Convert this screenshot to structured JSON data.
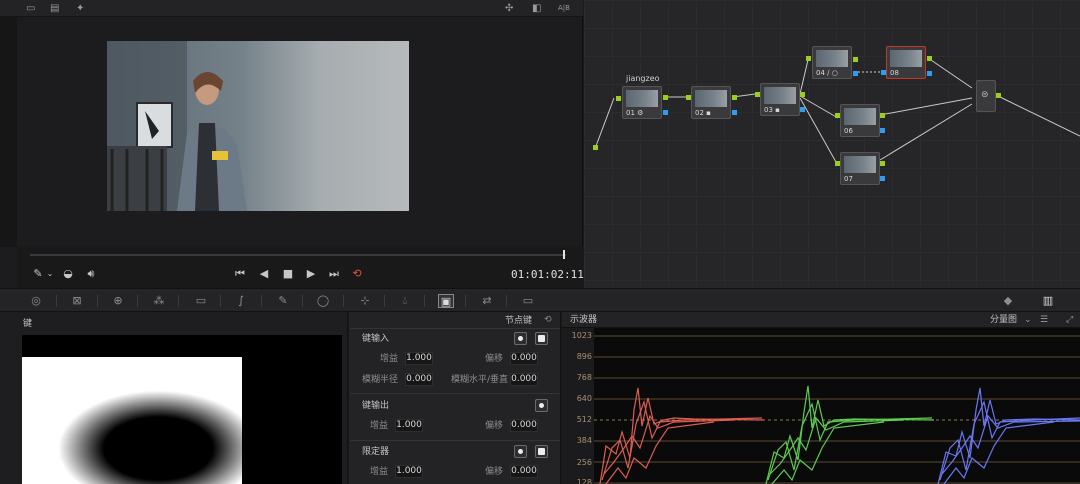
{
  "viewer": {
    "top_icons": [
      "layout-single-icon",
      "layout-split-icon",
      "wand-icon",
      "stars-icon",
      "image-wipe-icon"
    ],
    "ab_label": "A|B",
    "timecode": "01:01:02:11"
  },
  "transport": {
    "icons": [
      "eyedropper-icon",
      "chevron-down-icon",
      "highlight-icon",
      "speaker-icon",
      "skip-back-icon",
      "play-reverse-icon",
      "stop-icon",
      "play-icon",
      "skip-forward-icon",
      "loop-icon"
    ]
  },
  "nodes": {
    "input_label": "jiangzeo",
    "list": [
      {
        "label": "01 ⚙"
      },
      {
        "label": "02 ▪"
      },
      {
        "label": "03 ▪"
      },
      {
        "label": "04 ∕ ○"
      },
      {
        "label": "08"
      },
      {
        "label": "06"
      },
      {
        "label": "07"
      }
    ]
  },
  "palette": {
    "icons": [
      "camera-raw-icon",
      "color-match-icon",
      "color-wheels-icon",
      "rgb-mixer-icon",
      "motion-effects-icon",
      "curves-icon",
      "qualifier-icon",
      "window-icon",
      "tracker-icon",
      "blur-icon",
      "key-icon",
      "sizing-icon",
      "3d-icon",
      "stereo-icon",
      "scopes-toggle-icon"
    ]
  },
  "key_panel": {
    "title": "键",
    "node_key_label": "节点键",
    "key_input": {
      "title": "键输入",
      "gain_label": "增益",
      "gain_value": "1.000",
      "offset_label": "偏移",
      "offset_value": "0.000",
      "blur_radius_label": "模糊半径",
      "blur_radius_value": "0.000",
      "blur_hv_label": "模糊水平/垂直",
      "blur_hv_value": "0.000"
    },
    "key_output": {
      "title": "键输出",
      "gain_label": "增益",
      "gain_value": "1.000",
      "offset_label": "偏移",
      "offset_value": "0.000"
    },
    "qualifier": {
      "title": "限定器",
      "gain_label": "增益",
      "gain_value": "1.000",
      "offset_label": "偏移",
      "offset_value": "0.000"
    }
  },
  "scope": {
    "title": "示波器",
    "mode": "分量图",
    "y_ticks": [
      "1023",
      "896",
      "768",
      "640",
      "512",
      "384",
      "256",
      "128"
    ]
  }
}
